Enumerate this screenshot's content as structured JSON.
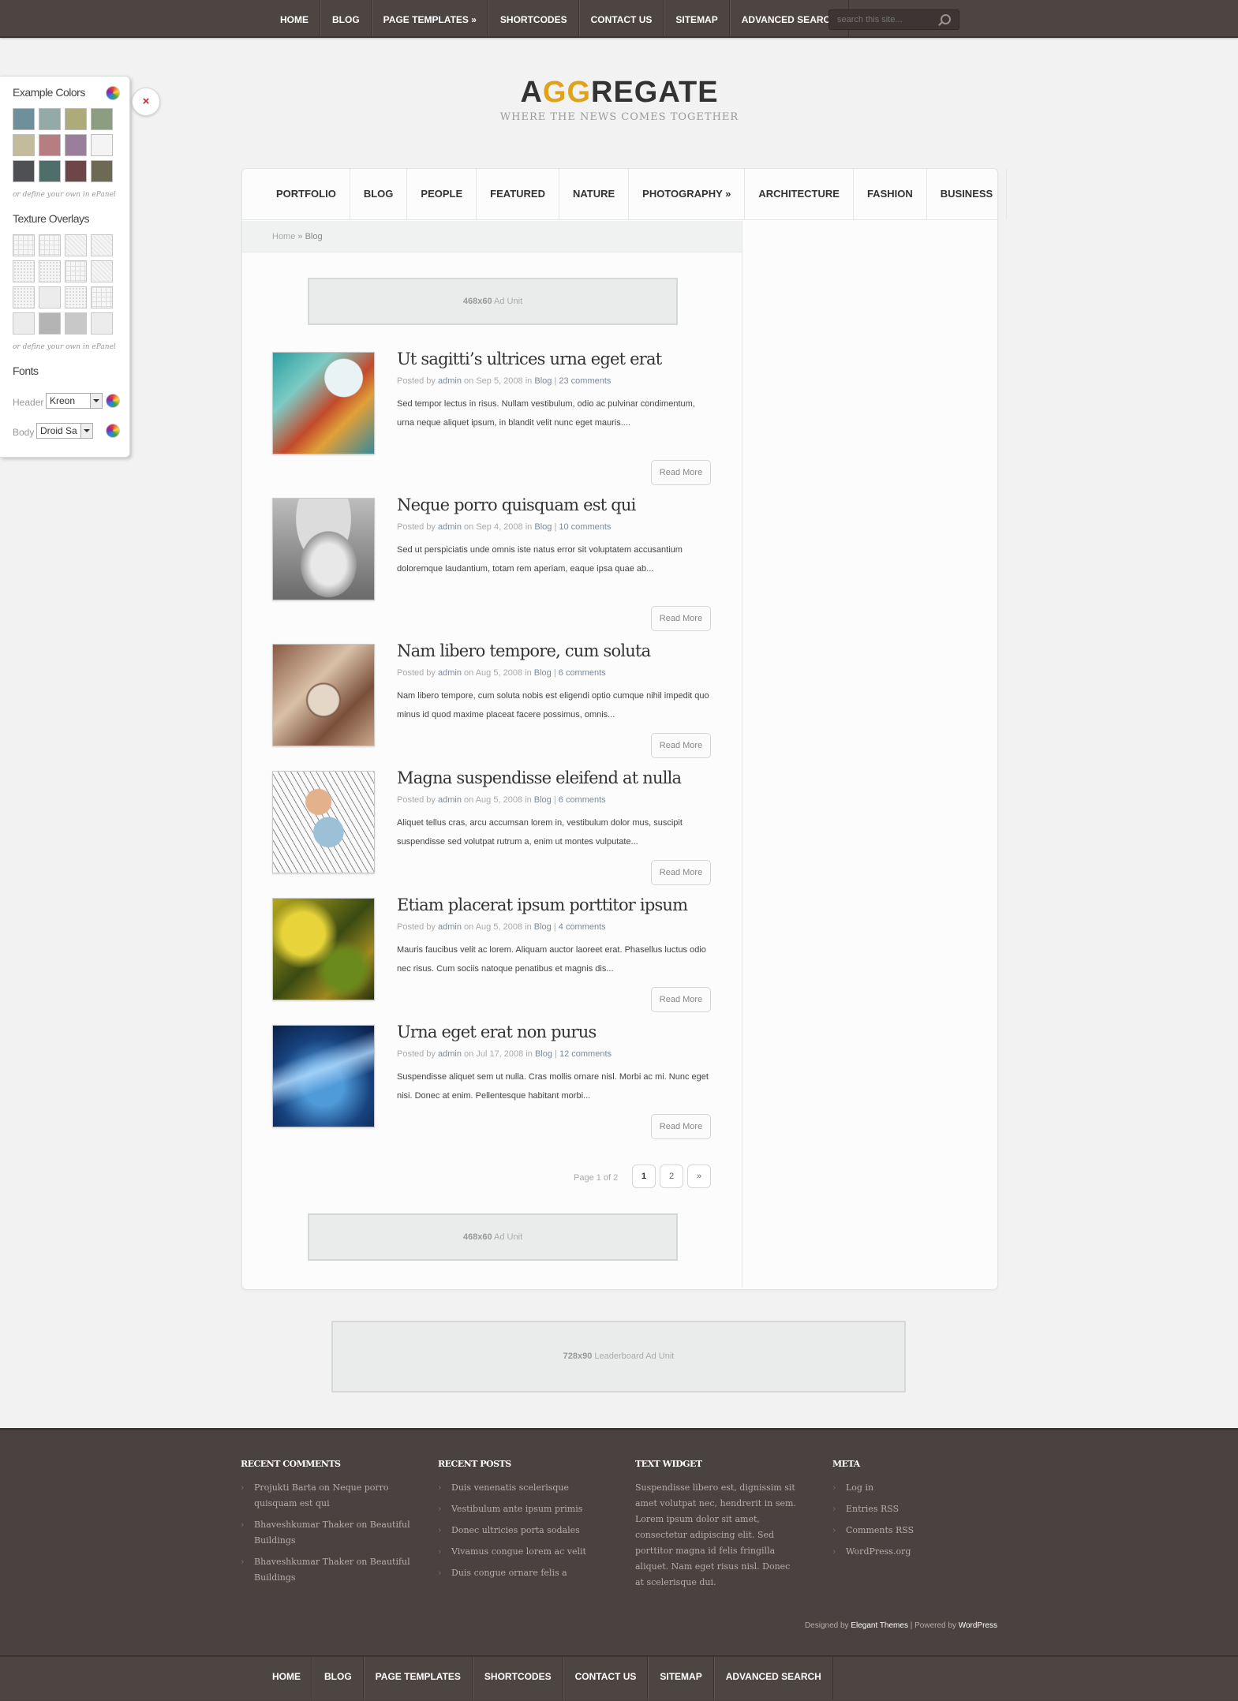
{
  "top_nav": [
    "HOME",
    "BLOG",
    "PAGE TEMPLATES »",
    "SHORTCODES",
    "CONTACT US",
    "SITEMAP",
    "ADVANCED SEARCH"
  ],
  "search": {
    "placeholder": "search this site..."
  },
  "logo": {
    "name_a": "A",
    "name_gg": "GG",
    "name_rest": "REGATE",
    "tagline": "WHERE THE NEWS COMES TOGETHER",
    "accent_color": "#e0a21b"
  },
  "epanel": {
    "colors_title": "Example Colors",
    "colors": [
      "#6e8f9c",
      "#93aaa6",
      "#aeab7b",
      "#8c9e82",
      "#c4bb9b",
      "#b67e80",
      "#9a7f9c",
      "#f4f4f4",
      "#4e5054",
      "#4f6d69",
      "#6e4548",
      "#6e6953"
    ],
    "colors_note": "or define your own in ePanel",
    "textures_title": "Texture Overlays",
    "textures_note": "or define your own in ePanel",
    "fonts_title": "Fonts",
    "header_label": "Header",
    "header_font": "Kreon",
    "body_label": "Body",
    "body_font": "Droid Sa",
    "close_symbol": "×"
  },
  "cat_nav": [
    "PORTFOLIO",
    "BLOG",
    "PEOPLE",
    "FEATURED",
    "NATURE",
    "PHOTOGRAPHY »",
    "ARCHITECTURE",
    "FASHION",
    "BUSINESS"
  ],
  "breadcrumb": {
    "home": "Home",
    "sep": " » ",
    "current": "Blog"
  },
  "ad_top": {
    "size": "468x60",
    "label": "Ad Unit"
  },
  "ad_bottom": {
    "size": "468x60",
    "label": "Ad Unit"
  },
  "leaderboard": {
    "size": "728x90",
    "label": "Leaderboard Ad Unit"
  },
  "meta_labels": {
    "posted_by": "Posted by",
    "on": "on",
    "in": "in",
    "sep": "|"
  },
  "posts": [
    {
      "title": "Ut sagitti’s ultrices urna eget erat",
      "author": "admin",
      "date": "Sep 5, 2008",
      "category": "Blog",
      "comments": "23 comments",
      "excerpt": "Sed tempor lectus in risus. Nullam vestibulum, odio ac pulvinar condimentum, urna neque aliquet ipsum, in blandit velit nunc eget mauris....",
      "read_more": "Read More"
    },
    {
      "title": "Neque porro quisquam est qui",
      "author": "admin",
      "date": "Sep 4, 2008",
      "category": "Blog",
      "comments": "10 comments",
      "excerpt": "Sed ut perspiciatis unde omnis iste natus error sit voluptatem accusantium doloremque laudantium, totam rem aperiam, eaque ipsa quae ab...",
      "read_more": "Read More"
    },
    {
      "title": "Nam libero tempore, cum soluta",
      "author": "admin",
      "date": "Aug 5, 2008",
      "category": "Blog",
      "comments": "6 comments",
      "excerpt": "Nam libero tempore, cum soluta nobis est eligendi optio cumque nihil impedit quo minus id quod maxime placeat facere possimus, omnis...",
      "read_more": "Read More"
    },
    {
      "title": "Magna suspendisse eleifend at nulla",
      "author": "admin",
      "date": "Aug 5, 2008",
      "category": "Blog",
      "comments": "6 comments",
      "excerpt": "Aliquet tellus cras, arcu accumsan lorem in, vestibulum dolor mus, suscipit suspendisse sed volutpat rutrum a, enim ut montes vulputate...",
      "read_more": "Read More"
    },
    {
      "title": "Etiam placerat ipsum porttitor ipsum",
      "author": "admin",
      "date": "Aug 5, 2008",
      "category": "Blog",
      "comments": "4 comments",
      "excerpt": "Mauris faucibus velit ac lorem. Aliquam auctor laoreet erat. Phasellus luctus odio nec risus. Cum sociis natoque penatibus et magnis dis...",
      "read_more": "Read More"
    },
    {
      "title": "Urna eget erat non purus",
      "author": "admin",
      "date": "Jul 17, 2008",
      "category": "Blog",
      "comments": "12 comments",
      "excerpt": "Suspendisse aliquet sem ut nulla. Cras mollis ornare nisl. Morbi ac mi. Nunc eget nisi. Donec at enim. Pellentesque habitant morbi...",
      "read_more": "Read More"
    }
  ],
  "pagination": {
    "label": "Page 1 of 2",
    "pages": [
      "1",
      "2"
    ],
    "next": "»"
  },
  "footer": {
    "recent_comments": {
      "title": "RECENT COMMENTS",
      "items": [
        "Projukti Barta on Neque porro quisquam est qui",
        "Bhaveshkumar Thaker on Beautiful Buildings",
        "Bhaveshkumar Thaker on Beautiful Buildings"
      ]
    },
    "recent_posts": {
      "title": "RECENT POSTS",
      "items": [
        "Duis venenatis scelerisque",
        "Vestibulum ante ipsum primis",
        "Donec ultricies porta sodales",
        "Vivamus congue lorem ac velit",
        "Duis congue ornare felis a"
      ]
    },
    "text_widget": {
      "title": "TEXT WIDGET",
      "text": "Suspendisse libero est, dignissim sit amet volutpat nec, hendrerit in sem. Lorem ipsum dolor sit amet, consectetur adipiscing elit. Sed porttitor magna id felis fringilla aliquet. Nam eget risus nisl. Donec at scelerisque dui."
    },
    "meta": {
      "title": "META",
      "items": [
        "Log in",
        "Entries RSS",
        "Comments RSS",
        "WordPress.org"
      ]
    },
    "credits": {
      "designed_by": "Designed by",
      "elegant": "Elegant Themes",
      "sep": "|",
      "powered_by": "Powered by",
      "wordpress": "WordPress"
    }
  },
  "bottom_nav": [
    "HOME",
    "BLOG",
    "PAGE TEMPLATES",
    "SHORTCODES",
    "CONTACT US",
    "SITEMAP",
    "ADVANCED SEARCH"
  ]
}
